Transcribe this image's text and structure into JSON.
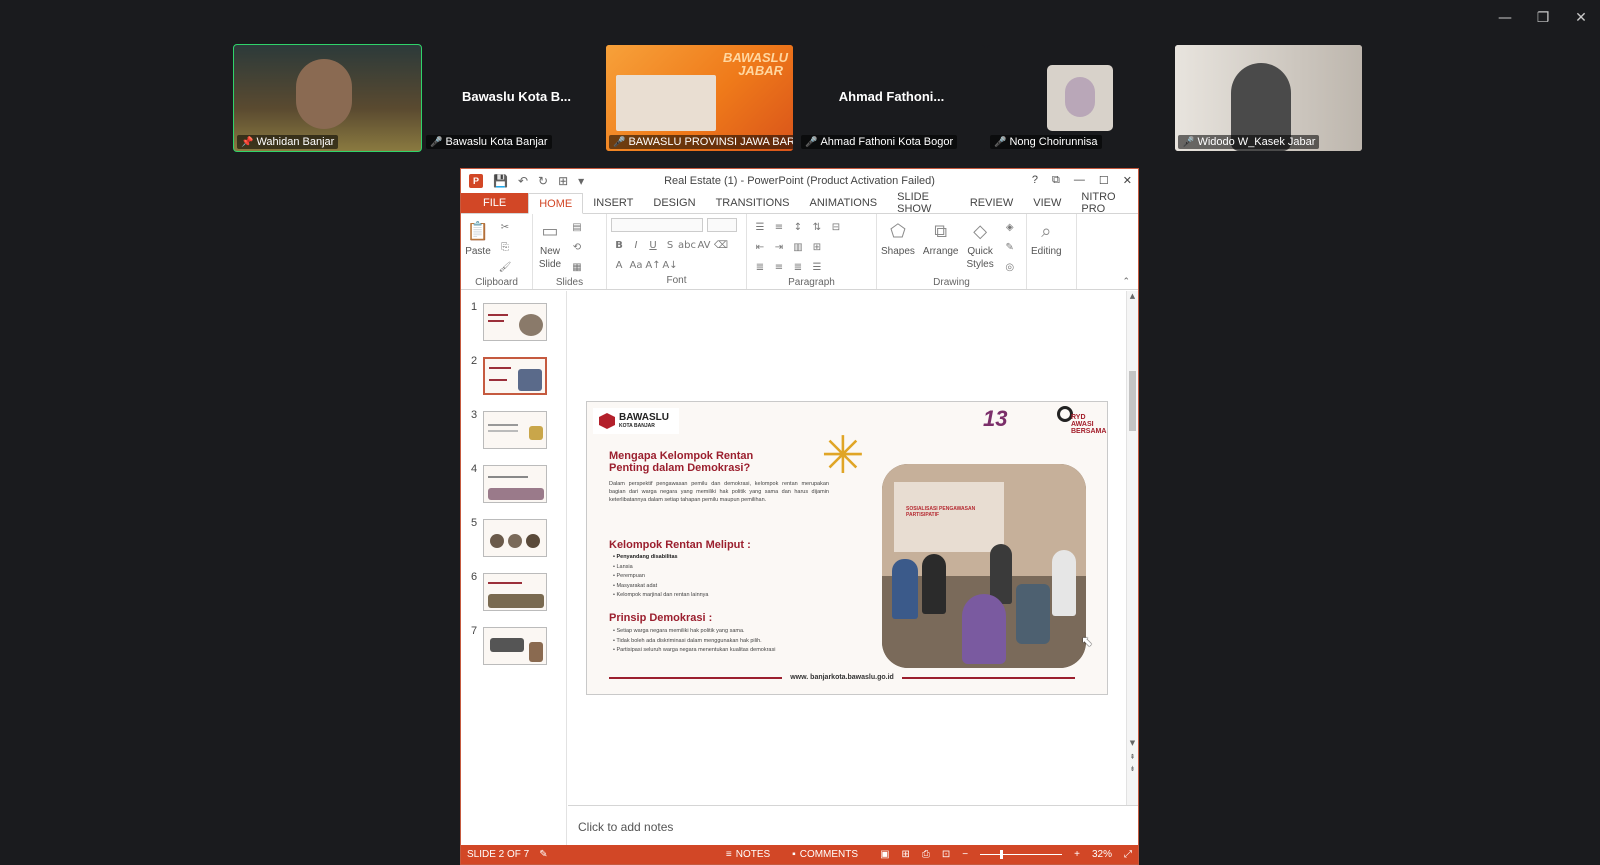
{
  "window_controls": {
    "minimize": "—",
    "restore": "❐",
    "close": "✕"
  },
  "participants": [
    {
      "name": "Wahidan Banjar",
      "display": "",
      "muted": false,
      "pinned": true,
      "active": true
    },
    {
      "name": "Bawaslu Kota Banjar",
      "display": "Bawaslu Kota B...",
      "muted": true
    },
    {
      "name": "BAWASLU PROVINSI JAWA BARAT",
      "display": "",
      "muted": true,
      "banner_text": "BAWASLU JABAR"
    },
    {
      "name": "Ahmad Fathoni Kota Bogor",
      "display": "Ahmad Fathoni...",
      "muted": true
    },
    {
      "name": "Nong Choirunnisa",
      "display": "",
      "muted": true
    },
    {
      "name": "Widodo W_Kasek Jabar",
      "display": "",
      "muted": true
    }
  ],
  "ppt": {
    "title": "Real Estate (1) - PowerPoint (Product Activation Failed)",
    "title_controls": [
      "?",
      "⧉",
      "—",
      "☐",
      "✕"
    ],
    "tabs": [
      "FILE",
      "HOME",
      "INSERT",
      "DESIGN",
      "TRANSITIONS",
      "ANIMATIONS",
      "SLIDE SHOW",
      "REVIEW",
      "VIEW",
      "NITRO PRO"
    ],
    "selected_tab": "HOME",
    "ribbon": {
      "clipboard": {
        "label": "Clipboard",
        "paste": "Paste"
      },
      "slides": {
        "label": "Slides",
        "new_slide": "New",
        "new_slide2": "Slide"
      },
      "font": {
        "label": "Font"
      },
      "paragraph": {
        "label": "Paragraph"
      },
      "drawing": {
        "label": "Drawing",
        "shapes": "Shapes",
        "arrange": "Arrange",
        "quick_styles": "Quick",
        "quick_styles2": "Styles"
      },
      "editing": {
        "label": "Editing"
      }
    },
    "thumbnails": [
      "1",
      "2",
      "3",
      "4",
      "5",
      "6",
      "7"
    ],
    "selected_slide": 2,
    "slide": {
      "logo_title": "BAWASLU",
      "logo_sub": "KOTA BANJAR",
      "anniv": "13",
      "bersama": "RYD AWASI BERSAMA",
      "heading": "Mengapa Kelompok Rentan Penting dalam Demokrasi?",
      "paragraph": "Dalam perspektif pengawasan pemilu dan demokrasi, kelompok rentan merupakan bagian dari warga negara yang memiliki hak politik yang sama dan harus dijamin keterlibatannya dalam setiap tahapan pemilu maupun pemilihan.",
      "group_heading": "Kelompok Rentan Meliput :",
      "groups": [
        "Penyandang disabilitas",
        "Lansia",
        "Perempuan",
        "Masyarakat adat",
        "Kelompok marjinal dan rentan lainnya"
      ],
      "principle_heading": "Prinsip Demokrasi :",
      "principles": [
        "Setiap warga negara memiliki hak politik yang sama.",
        "Tidak boleh ada diskriminasi dalam menggunakan hak pilih.",
        "Partisipasi seluruh warga negara menentukan kualitas demokrasi"
      ],
      "photo_banner": "SOSIALISASI PENGAWASAN PARTISIPATIF",
      "footer_url": "www. banjarkota.bawaslu.go.id"
    },
    "notes_placeholder": "Click to add notes",
    "status": {
      "slide_indicator": "SLIDE 2 OF 7",
      "notes": "NOTES",
      "comments": "COMMENTS",
      "zoom": "32%"
    }
  }
}
